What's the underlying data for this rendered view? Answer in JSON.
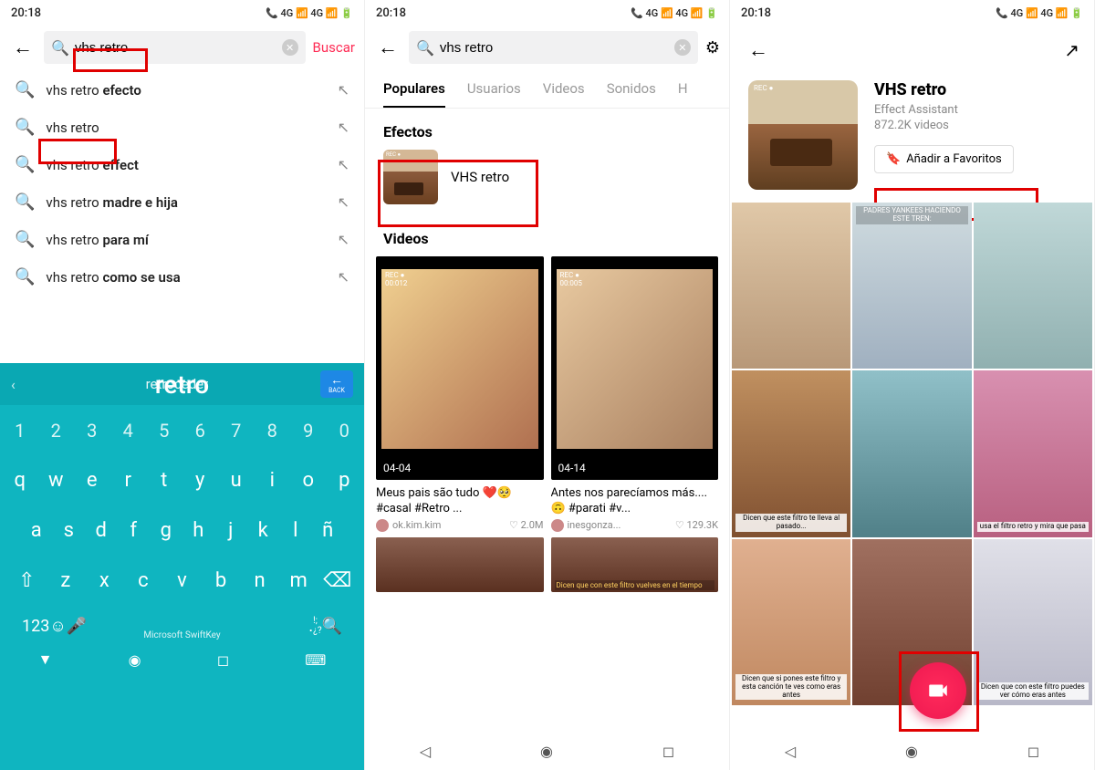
{
  "status": {
    "time": "20:18",
    "indicators": "📞 4G 📶 4G 📶 🔋"
  },
  "phone1": {
    "search_value": "vhs retro",
    "search_btn": "Buscar",
    "suggestions": [
      {
        "pre": "vhs retro ",
        "bold": "efecto"
      },
      {
        "pre": "vhs retro",
        "bold": ""
      },
      {
        "pre": "vhs retro ",
        "bold": "effect"
      },
      {
        "pre": "vhs retro ",
        "bold": "madre e hija"
      },
      {
        "pre": "vhs retro ",
        "bold": "para mí"
      },
      {
        "pre": "vhs retro ",
        "bold": "como se usa"
      }
    ],
    "kb": {
      "sugg1": "retroceder",
      "sugg2": "retro",
      "back": "BACK",
      "row_num": [
        "1",
        "2",
        "3",
        "4",
        "5",
        "6",
        "7",
        "8",
        "9",
        "0"
      ],
      "row1": [
        "q",
        "w",
        "e",
        "r",
        "t",
        "y",
        "u",
        "i",
        "o",
        "p"
      ],
      "row2": [
        "a",
        "s",
        "d",
        "f",
        "g",
        "h",
        "j",
        "k",
        "l",
        "ñ"
      ],
      "row3": [
        "⇧",
        "z",
        "x",
        "c",
        "v",
        "b",
        "n",
        "m",
        "⌫"
      ],
      "row4_left": "123",
      "brand": "Microsoft SwiftKey"
    }
  },
  "phone2": {
    "search_value": "vhs retro",
    "tabs": [
      "Populares",
      "Usuarios",
      "Videos",
      "Sonidos",
      "H"
    ],
    "section_effects": "Efectos",
    "effect_name": "VHS retro",
    "section_videos": "Videos",
    "videos": [
      {
        "date": "04-04",
        "caption": "Meus pais são tudo ❤️🥺 #casal #Retro ...",
        "user": "ok.kim.kim",
        "likes": "2.0M"
      },
      {
        "date": "04-14",
        "caption": "Antes nos parecíamos más.... 🙃 #parati #v...",
        "user": "inesgonza...",
        "likes": "129.3K"
      }
    ],
    "bottom_caption": "Dicen que con este filtro vuelves en el tiempo"
  },
  "phone3": {
    "title": "VHS retro",
    "author": "Effect Assistant",
    "count": "872.2K videos",
    "fav": "Añadir a Favoritos",
    "cells": [
      {
        "txt": ""
      },
      {
        "txt": "PADRES YANKEES\nHACIENDO ESTE TREN:",
        "pos": "top"
      },
      {
        "txt": ""
      },
      {
        "txt": "Dicen que este filtro te lleva al pasado...",
        "pos": "bottom"
      },
      {
        "txt": ""
      },
      {
        "txt": "usa el filtro retro y mira que pasa",
        "pos": "bottom"
      },
      {
        "txt": "Dicen que si pones este filtro y esta canción te ves como eras antes",
        "pos": "bottom"
      },
      {
        "txt": ""
      },
      {
        "txt": "Dicen que con este filtro puedes ver cómo eras antes",
        "pos": "bottom"
      }
    ]
  }
}
